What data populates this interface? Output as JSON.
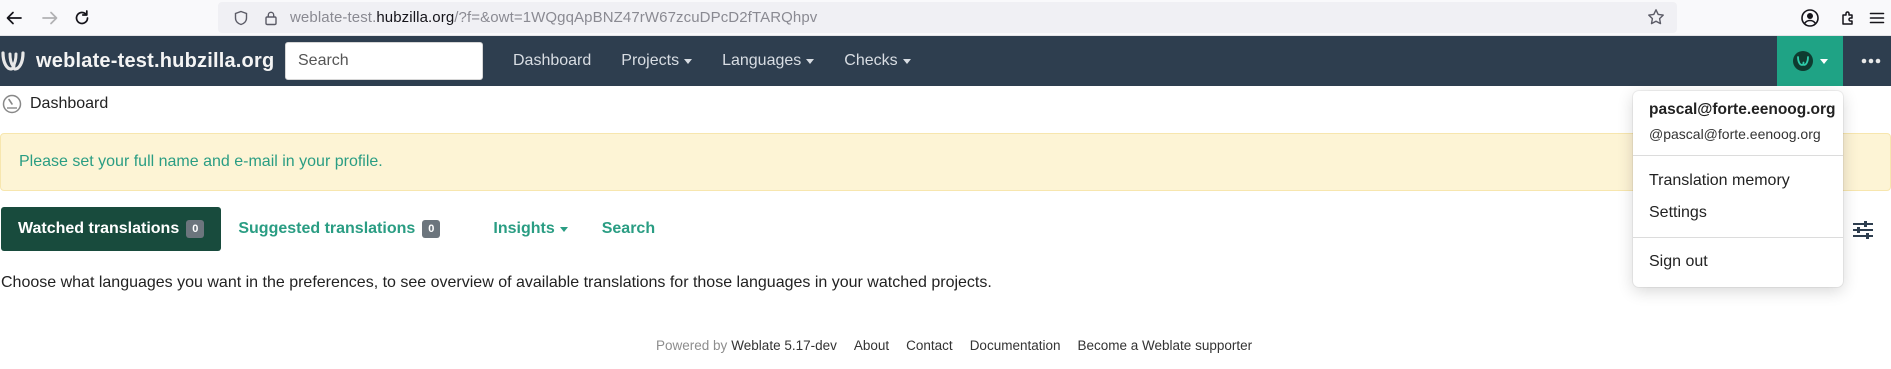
{
  "browser": {
    "url_prefix": "weblate-test.",
    "url_domain": "hubzilla.org",
    "url_rest": "/?f=&owt=1WQgqApBNZ47rW67zcuDPcD2fTARQhpv"
  },
  "navbar": {
    "brand": "weblate-test.hubzilla.org",
    "search_placeholder": "Search",
    "links": [
      "Dashboard",
      "Projects",
      "Languages",
      "Checks"
    ]
  },
  "breadcrumb": {
    "label": "Dashboard"
  },
  "alert": {
    "text": "Please set your full name and e-mail in your profile."
  },
  "tabs": {
    "watched": {
      "label": "Watched translations",
      "count": "0"
    },
    "suggested": {
      "label": "Suggested translations",
      "count": "0"
    },
    "insights": {
      "label": "Insights"
    },
    "search": {
      "label": "Search"
    }
  },
  "main": {
    "info": "Choose what languages you want in the preferences, to see overview of available translations for those languages in your watched projects."
  },
  "footer": {
    "powered_by": "Powered by",
    "weblate_version": "Weblate 5.17-dev",
    "links": [
      "About",
      "Contact",
      "Documentation",
      "Become a Weblate supporter"
    ]
  },
  "user_menu": {
    "full_name": "pascal@forte.eenoog.org",
    "username": "@pascal@forte.eenoog.org",
    "items": [
      "Translation memory",
      "Settings"
    ],
    "sign_out": "Sign out"
  },
  "colors": {
    "navbar": "#2e3e4f",
    "accent": "#2a9d83",
    "active_tab": "#184b3d",
    "alert_bg": "#fdf4d5"
  }
}
